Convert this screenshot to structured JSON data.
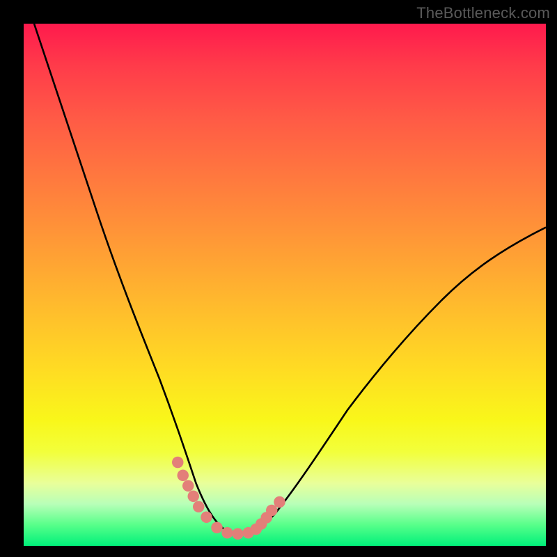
{
  "watermark": {
    "text": "TheBottleneck.com"
  },
  "colors": {
    "frame": "#000000",
    "curve": "#000000",
    "marker": "#e37f79",
    "gradient_top": "#ff1a4d",
    "gradient_bottom": "#00f07a"
  },
  "chart_data": {
    "type": "line",
    "title": "",
    "xlabel": "",
    "ylabel": "",
    "xlim": [
      0,
      100
    ],
    "ylim": [
      0,
      100
    ],
    "grid": false,
    "legend": false,
    "annotations": [
      "TheBottleneck.com"
    ],
    "series": [
      {
        "name": "bottleneck-curve",
        "x": [
          2,
          5,
          8,
          12,
          16,
          20,
          24,
          27,
          30,
          32,
          34,
          36,
          38,
          40,
          42,
          44,
          48,
          52,
          56,
          60,
          66,
          72,
          78,
          84,
          90,
          96,
          100
        ],
        "y": [
          100,
          90,
          80,
          68,
          56,
          45,
          35,
          27,
          20,
          15,
          11,
          8,
          5,
          3,
          2,
          2,
          3,
          6,
          11,
          17,
          26,
          34,
          41,
          47,
          53,
          58,
          61
        ]
      }
    ],
    "markers": [
      {
        "name": "highlight-dots",
        "x": [
          29.5,
          30.5,
          31.5,
          32.5,
          33.5,
          35,
          37,
          39,
          41,
          43,
          44.5,
          45.5,
          46.5,
          47.5,
          49
        ],
        "y": [
          16,
          13.5,
          11.5,
          9.5,
          7.5,
          5.5,
          3.5,
          2.5,
          2.3,
          2.5,
          3.2,
          4.2,
          5.4,
          6.8,
          8.4
        ]
      }
    ]
  }
}
